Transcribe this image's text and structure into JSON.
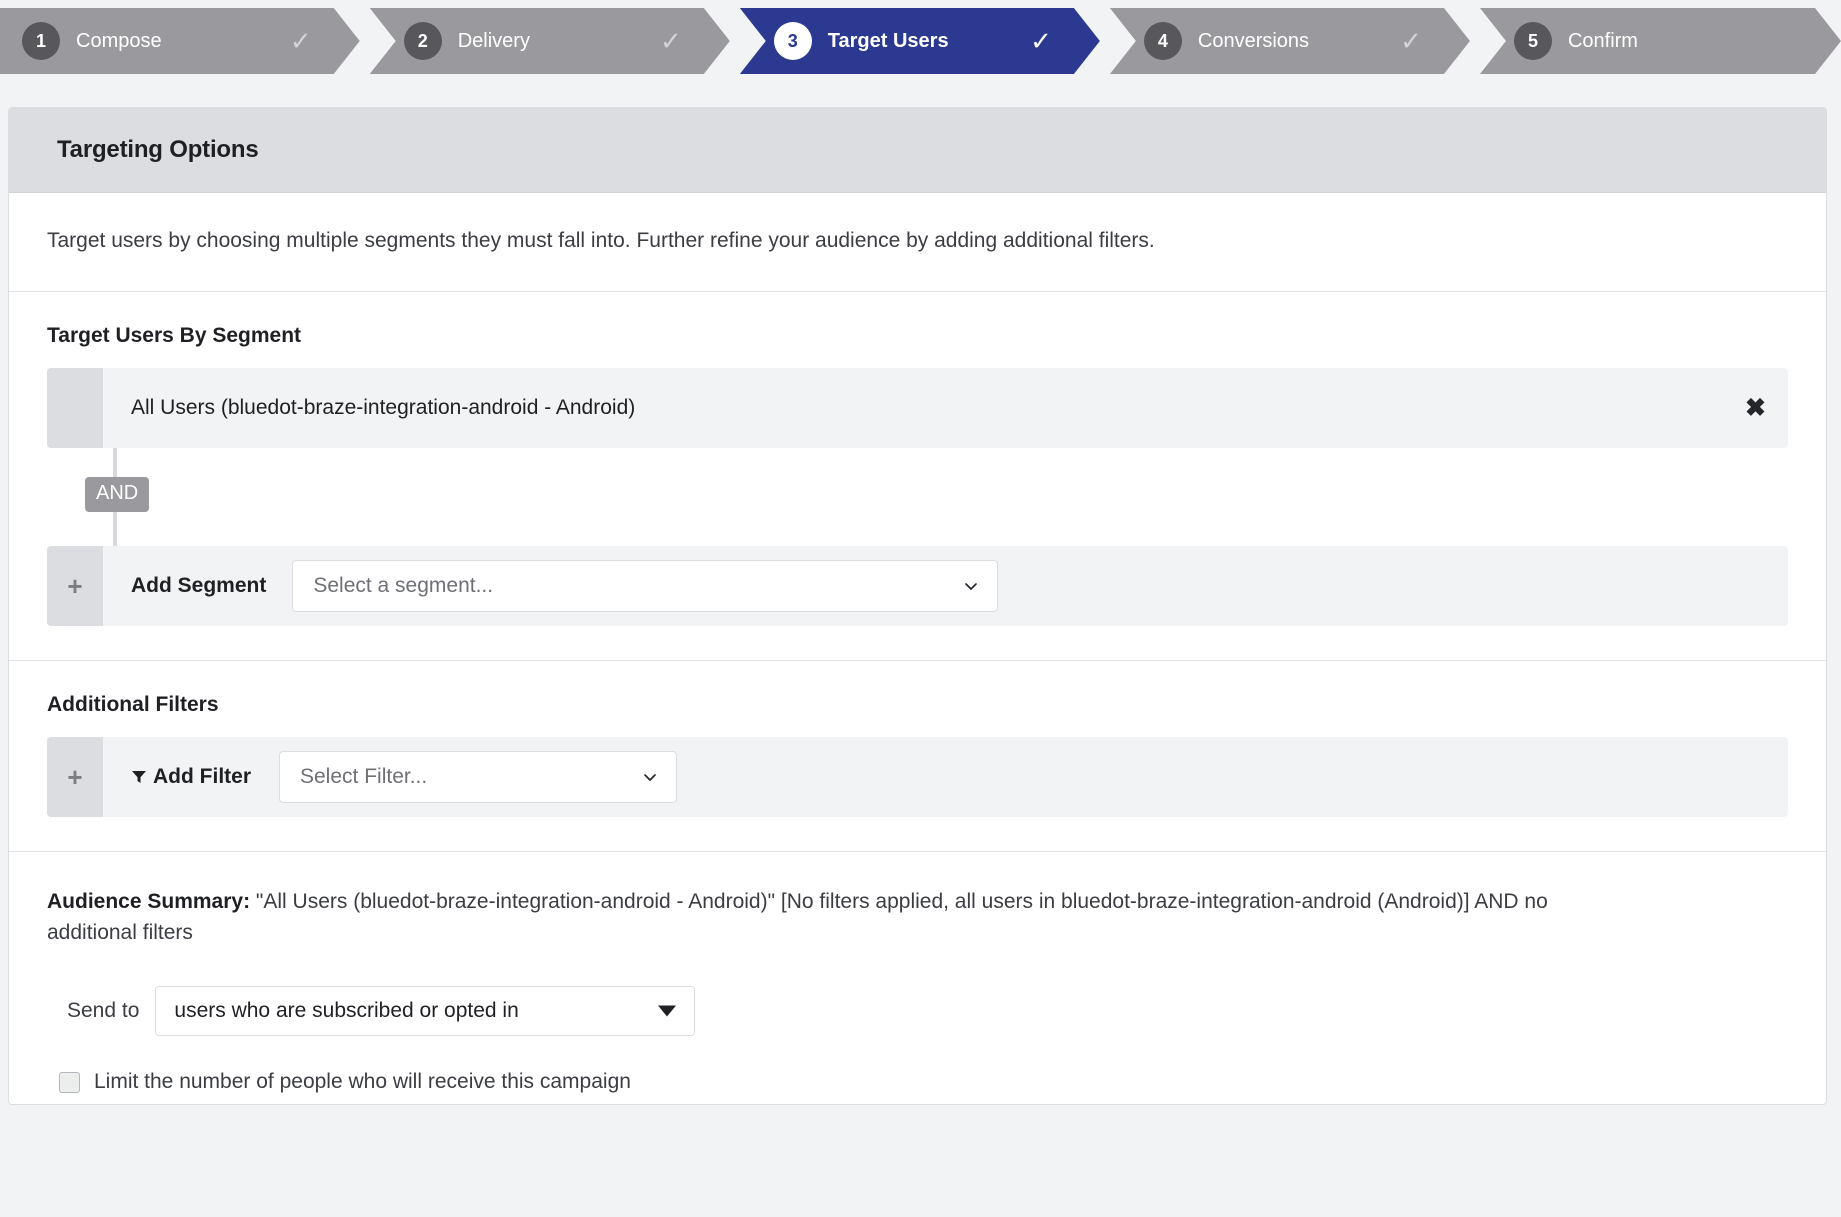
{
  "steps": [
    {
      "num": "1",
      "label": "Compose",
      "check": "✓",
      "active": false,
      "checked": true
    },
    {
      "num": "2",
      "label": "Delivery",
      "check": "✓",
      "active": false,
      "checked": true
    },
    {
      "num": "3",
      "label": "Target Users",
      "check": "✓",
      "active": true,
      "checked": true
    },
    {
      "num": "4",
      "label": "Conversions",
      "check": "✓",
      "active": false,
      "checked": true
    },
    {
      "num": "5",
      "label": "Confirm",
      "check": "",
      "active": false,
      "checked": false
    }
  ],
  "panel": {
    "title": "Targeting Options",
    "intro": "Target users by choosing multiple segments they must fall into. Further refine your audience by adding additional filters."
  },
  "segments": {
    "section_title": "Target Users By Segment",
    "selected_segment": "All Users (bluedot-braze-integration-android - Android)",
    "remove_icon": "✖",
    "operator_badge": "AND",
    "add_handle": "+",
    "add_label": "Add Segment",
    "select_placeholder": "Select a segment..."
  },
  "filters": {
    "section_title": "Additional Filters",
    "add_handle": "+",
    "add_label": "Add Filter",
    "select_placeholder": "Select Filter..."
  },
  "audience": {
    "summary_label": "Audience Summary:",
    "summary_text": " \"All Users (bluedot-braze-integration-android - Android)\" [No filters applied, all users in bluedot-braze-integration-android (Android)] AND no additional filters",
    "send_to_label": "Send to",
    "send_to_value": "users who are subscribed or opted in",
    "limit_checkbox_label": "Limit the number of people who will receive this campaign"
  },
  "colors": {
    "active_step": "#2b3990",
    "inactive_step": "#9a9a9e",
    "page_bg": "#f2f3f5",
    "header_bg": "#dcdde1"
  }
}
